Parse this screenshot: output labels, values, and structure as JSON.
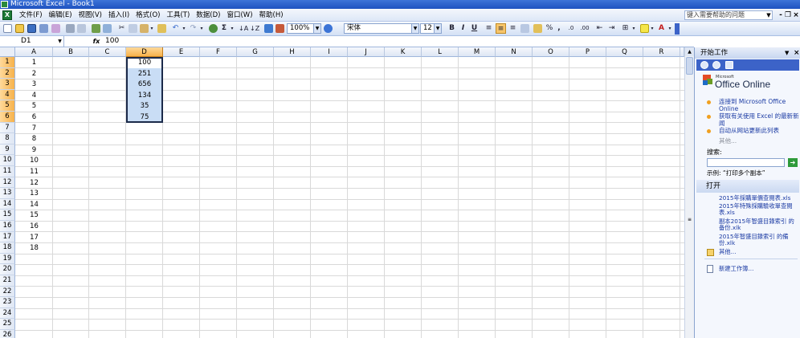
{
  "titlebar": {
    "title": "Microsoft Excel - Book1"
  },
  "menubar": {
    "items": [
      "文件(F)",
      "编辑(E)",
      "视图(V)",
      "插入(I)",
      "格式(O)",
      "工具(T)",
      "数据(D)",
      "窗口(W)",
      "帮助(H)"
    ],
    "help_placeholder": "键入需要帮助的问题"
  },
  "toolbar": {
    "zoom": "100%",
    "font_name": "宋体",
    "font_size": "12",
    "bold": "B",
    "italic": "I",
    "underline": "U",
    "sum": "Σ",
    "percent": "%",
    "comma": ","
  },
  "formula_bar": {
    "name_box": "D1",
    "fx": "fx",
    "formula": "100"
  },
  "sheet": {
    "columns": [
      "A",
      "B",
      "C",
      "D",
      "E",
      "F",
      "G",
      "H",
      "I",
      "J",
      "K",
      "L",
      "M",
      "N",
      "O",
      "P",
      "Q",
      "R"
    ],
    "selected_column": "D",
    "rows": [
      "1",
      "2",
      "3",
      "4",
      "5",
      "6",
      "7",
      "8",
      "9",
      "10",
      "11",
      "12",
      "13",
      "14",
      "15",
      "16",
      "17",
      "18",
      "19",
      "20",
      "21",
      "22",
      "23",
      "24",
      "25",
      "26"
    ],
    "column_a_values": [
      "1",
      "2",
      "3",
      "4",
      "5",
      "6",
      "7",
      "8",
      "9",
      "10",
      "11",
      "12",
      "13",
      "14",
      "15",
      "16",
      "17",
      "18"
    ],
    "column_d_values": [
      "100",
      "251",
      "656",
      "134",
      "35",
      "75"
    ],
    "selection": "D1:D6"
  },
  "taskpane": {
    "title": "开始工作",
    "brand_small": "Microsoft",
    "brand_big": "Office Online",
    "links": [
      "连接到 Microsoft Office Online",
      "获取有关使用 Excel 的最新新闻",
      "自动从网站更新此列表"
    ],
    "more": "其他...",
    "search_label": "搜索:",
    "example": "示例: “打印多个副本”",
    "open_header": "打开",
    "files": [
      "2015年採購單價查閱表.xls",
      "2015年特殊採購驗收單查閱表.xls",
      "副本2015年智盛目錄索引 的备份.xlk",
      "2015年智盛目錄索引 的備份.xlk"
    ],
    "open_more": "其他...",
    "new_workbook": "新建工作簿..."
  }
}
